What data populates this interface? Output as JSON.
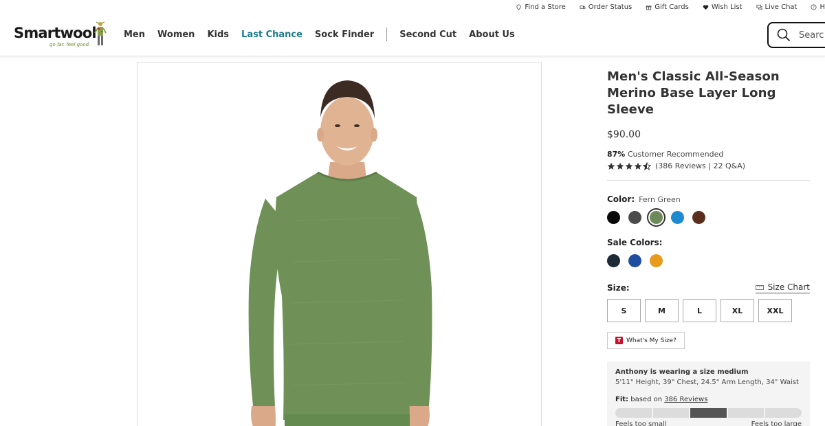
{
  "utility_bar": {
    "items": [
      {
        "label": "Find a Store",
        "icon": "location-pin-icon"
      },
      {
        "label": "Order Status",
        "icon": "truck-icon"
      },
      {
        "label": "Gift Cards",
        "icon": "gift-icon"
      },
      {
        "label": "Wish List",
        "icon": "heart-icon"
      },
      {
        "label": "Live Chat",
        "icon": "chat-icon"
      },
      {
        "label": "H",
        "icon": "help-icon"
      }
    ]
  },
  "header": {
    "logo_text": "Smartwool",
    "logo_tagline": "go far. feel good.",
    "nav": [
      {
        "label": "Men"
      },
      {
        "label": "Women"
      },
      {
        "label": "Kids"
      },
      {
        "label": "Last Chance"
      },
      {
        "label": "Sock Finder"
      },
      {
        "label": "Second Cut"
      },
      {
        "label": "About Us"
      }
    ],
    "search_placeholder": "Searc"
  },
  "product": {
    "title_line1": "Men's Classic All-Season",
    "title_line2": "Merino Base Layer Long Sleeve",
    "price": "$90.00",
    "recommended_pct": "87%",
    "recommended_text": "Customer Recommended",
    "rating": 4.5,
    "reviews_text": "(386 Reviews | 22 Q&A)",
    "color_label": "Color:",
    "color_value": "Fern Green",
    "colors": [
      {
        "name": "Black",
        "hex": "#0a0a0a"
      },
      {
        "name": "Charcoal",
        "hex": "#4a4a4a"
      },
      {
        "name": "Fern Green",
        "hex": "#6e8a5a"
      },
      {
        "name": "Blue",
        "hex": "#1e8ad0"
      },
      {
        "name": "Brown",
        "hex": "#5a2e1c"
      }
    ],
    "sale_colors_label": "Sale Colors:",
    "sale_colors": [
      {
        "name": "Deep Navy",
        "hex": "#1b2a36"
      },
      {
        "name": "Blue Black",
        "hex": "#1f4ea0"
      },
      {
        "name": "Honey Gold",
        "hex": "#e89a1c"
      }
    ],
    "size_label": "Size:",
    "size_chart_label": "Size Chart",
    "sizes": [
      "S",
      "M",
      "L",
      "XL",
      "XXL"
    ],
    "whats_my_size": "What's My Size?",
    "model_info_heading": "Anthony is wearing a size medium",
    "model_info_detail": "5'11\" Height, 39\" Chest, 24.5\" Arm Length, 34\" Waist",
    "fit_label": "Fit:",
    "fit_based_on": "based on",
    "fit_reviews_link": "386 Reviews",
    "fit_segments": 5,
    "fit_active_segment": 3,
    "fit_low_label": "Feels too small",
    "fit_high_label": "Feels too large"
  },
  "colors": {
    "accent": "#1d7a8c",
    "shirt": "#6e8f56"
  }
}
